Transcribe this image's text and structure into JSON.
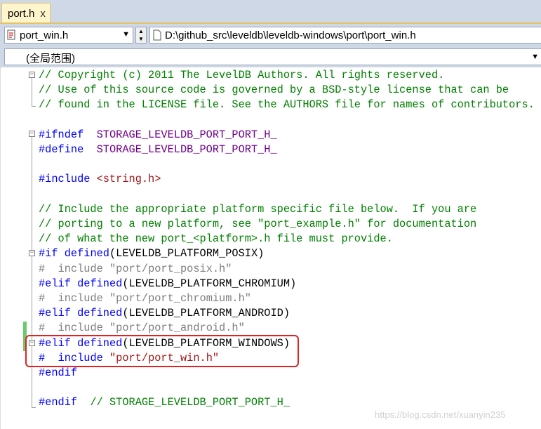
{
  "tab": {
    "title": "port.h",
    "close_glyph": "x"
  },
  "nav": {
    "file_combo": "port_win.h",
    "path_combo": "D:\\github_src\\leveldb\\leveldb-windows\\port\\port_win.h"
  },
  "scope": {
    "label": "(全局范围)"
  },
  "code": [
    [
      [
        "c",
        "// Copyright (c) 2011 The LevelDB Authors. All rights reserved."
      ]
    ],
    [
      [
        "c",
        "// Use of this source code is governed by a BSD-style license that can be"
      ]
    ],
    [
      [
        "c",
        "// found in the LICENSE file. See the AUTHORS file for names of contributors."
      ]
    ],
    [],
    [
      [
        "k",
        "#ifndef"
      ],
      [
        "",
        "  "
      ],
      [
        "m",
        "STORAGE_LEVELDB_PORT_PORT_H_"
      ]
    ],
    [
      [
        "k",
        "#define"
      ],
      [
        "",
        "  "
      ],
      [
        "m",
        "STORAGE_LEVELDB_PORT_PORT_H_"
      ]
    ],
    [],
    [
      [
        "k",
        "#include"
      ],
      [
        "",
        " "
      ],
      [
        "s",
        "<string.h>"
      ]
    ],
    [],
    [
      [
        "c",
        "// Include the appropriate platform specific file below.  If you are"
      ]
    ],
    [
      [
        "c",
        "// porting to a new platform, see \"port_example.h\" for documentation"
      ]
    ],
    [
      [
        "c",
        "// of what the new port_<platform>.h file must provide."
      ]
    ],
    [
      [
        "k",
        "#if"
      ],
      [
        "",
        " "
      ],
      [
        "k",
        "defined"
      ],
      [
        "",
        "(LEVELDB_PLATFORM_POSIX)"
      ]
    ],
    [
      [
        "i",
        "#  "
      ],
      [
        "ik",
        "include"
      ],
      [
        "i",
        " "
      ],
      [
        "is",
        "\"port/port_posix.h\""
      ]
    ],
    [
      [
        "k",
        "#elif"
      ],
      [
        "",
        " "
      ],
      [
        "k",
        "defined"
      ],
      [
        "",
        "(LEVELDB_PLATFORM_CHROMIUM)"
      ]
    ],
    [
      [
        "i",
        "#  "
      ],
      [
        "ik",
        "include"
      ],
      [
        "i",
        " "
      ],
      [
        "is",
        "\"port/port_chromium.h\""
      ]
    ],
    [
      [
        "k",
        "#elif"
      ],
      [
        "",
        " "
      ],
      [
        "k",
        "defined"
      ],
      [
        "",
        "(LEVELDB_PLATFORM_ANDROID)"
      ]
    ],
    [
      [
        "i",
        "#  "
      ],
      [
        "ik",
        "include"
      ],
      [
        "i",
        " "
      ],
      [
        "is",
        "\"port/port_android.h\""
      ]
    ],
    [
      [
        "k",
        "#elif"
      ],
      [
        "",
        " "
      ],
      [
        "k",
        "defined"
      ],
      [
        "",
        "(LEVELDB_PLATFORM_WINDOWS)"
      ]
    ],
    [
      [
        "k",
        "#"
      ],
      [
        "",
        "  "
      ],
      [
        "k",
        "include"
      ],
      [
        "",
        " "
      ],
      [
        "s",
        "\"port/port_win.h\""
      ]
    ],
    [
      [
        "k",
        "#endif"
      ]
    ],
    [],
    [
      [
        "k",
        "#endif"
      ],
      [
        "",
        "  "
      ],
      [
        "c",
        "// STORAGE_LEVELDB_PORT_PORT_H_"
      ]
    ]
  ],
  "watermark": "https://blog.csdn.net/xuanyin235"
}
